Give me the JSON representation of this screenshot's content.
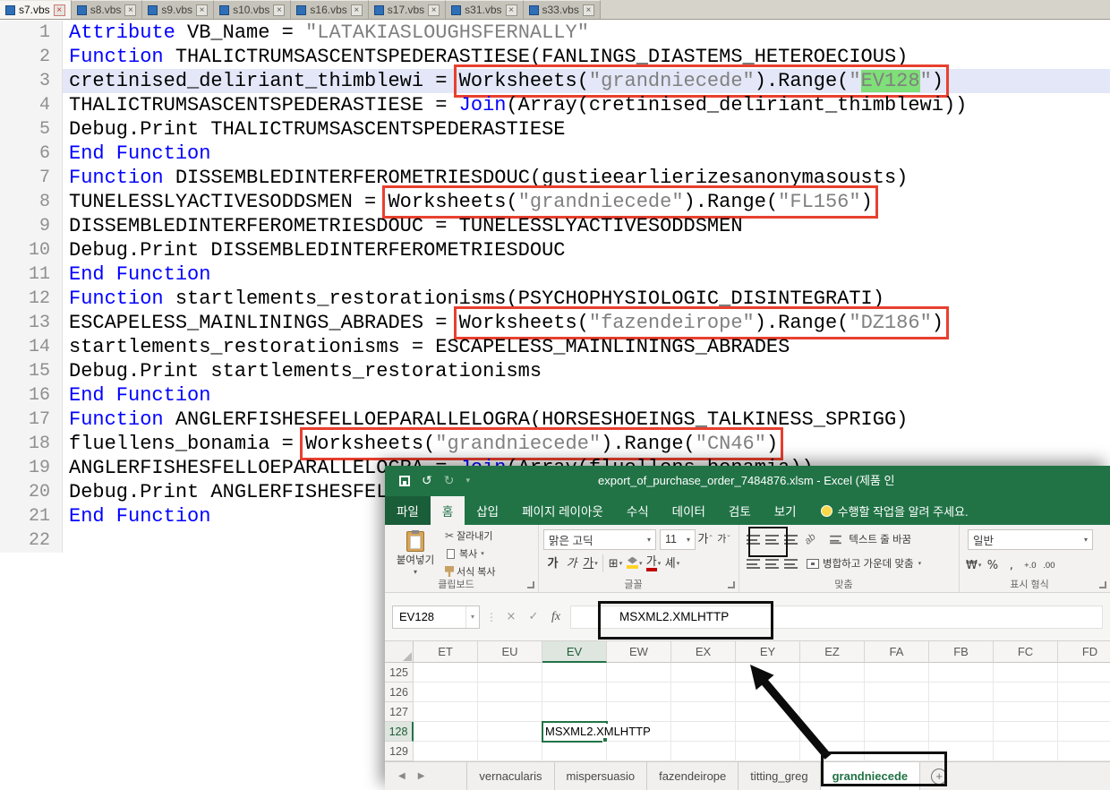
{
  "icons": {
    "close": "×",
    "undo": "↺",
    "redo": "↻",
    "dropdown": "▾",
    "cut": "✂",
    "borders": "⊞",
    "accounting": "₩",
    "percent": "%",
    "comma": ",",
    "inc_decimal": "+.0",
    "dec_decimal": ".00",
    "ellipsis": "⋮",
    "cancel": "×",
    "check": "✓",
    "fx": "fx",
    "nav_prev": "◀",
    "nav_next": "▶",
    "plus": "+",
    "hangul_ga": "가",
    "phonetic": "셰",
    "orientation": "ab"
  },
  "colors": {
    "excel_green": "#217346",
    "annotation_red": "#e8402f",
    "annotation_black": "#101010",
    "keyword_blue": "#0000ff",
    "string_gray": "#808080",
    "highlight_green": "#7fdf78",
    "selected_line": "#e3e7f7"
  },
  "editor": {
    "tabs": [
      {
        "label": "s7.vbs",
        "active": true
      },
      {
        "label": "s8.vbs",
        "active": false
      },
      {
        "label": "s9.vbs",
        "active": false
      },
      {
        "label": "s10.vbs",
        "active": false
      },
      {
        "label": "s16.vbs",
        "active": false
      },
      {
        "label": "s17.vbs",
        "active": false
      },
      {
        "label": "s31.vbs",
        "active": false
      },
      {
        "label": "s33.vbs",
        "active": false
      }
    ],
    "lines": [
      {
        "n": "1",
        "segments": [
          {
            "t": "Attribute",
            "c": "k"
          },
          {
            "t": " VB_Name = ",
            "c": "p"
          },
          {
            "t": "\"LATAKIASLOUGHSFERNALLY\"",
            "c": "s"
          }
        ]
      },
      {
        "n": "2",
        "segments": [
          {
            "t": "Function",
            "c": "k"
          },
          {
            "t": " THALICTRUMSASCENTSPEDERASTIESE(FANLINGS_DIASTEMS_HETEROECIOUS)",
            "c": "p"
          }
        ]
      },
      {
        "n": "3",
        "selected": true,
        "segments": [
          {
            "t": "cretinised_deliriant_thimblewi = ",
            "c": "p"
          },
          {
            "t": "Worksheets(",
            "c": "p",
            "box": true
          },
          {
            "t": "\"grandniecede\"",
            "c": "s",
            "box": true
          },
          {
            "t": ").Range(",
            "c": "p",
            "box": true
          },
          {
            "t": "\"",
            "c": "s",
            "box": true
          },
          {
            "t": "EV128",
            "c": "s",
            "box": true,
            "hl": true
          },
          {
            "t": "\"",
            "c": "s",
            "box": true
          },
          {
            "t": ")",
            "c": "p",
            "box": true
          }
        ]
      },
      {
        "n": "4",
        "segments": [
          {
            "t": "THALICTRUMSASCENTSPEDERASTIESE = ",
            "c": "p"
          },
          {
            "t": "Join",
            "c": "k"
          },
          {
            "t": "(Array(cretinised_deliriant_thimblewi))",
            "c": "p"
          }
        ]
      },
      {
        "n": "5",
        "segments": [
          {
            "t": "Debug.Print THALICTRUMSASCENTSPEDERASTIESE",
            "c": "p"
          }
        ]
      },
      {
        "n": "6",
        "segments": [
          {
            "t": "End Function",
            "c": "k"
          }
        ]
      },
      {
        "n": "7",
        "segments": [
          {
            "t": "Function",
            "c": "k"
          },
          {
            "t": " DISSEMBLEDINTERFEROMETRIESDOUC(gustieearlierizesanonymasousts)",
            "c": "p"
          }
        ]
      },
      {
        "n": "8",
        "segments": [
          {
            "t": "TUNELESSLYACTIVESODDSMEN = ",
            "c": "p"
          },
          {
            "t": "Worksheets(",
            "c": "p",
            "box": true
          },
          {
            "t": "\"grandniecede\"",
            "c": "s",
            "box": true
          },
          {
            "t": ").Range(",
            "c": "p",
            "box": true
          },
          {
            "t": "\"FL156\"",
            "c": "s",
            "box": true
          },
          {
            "t": ")",
            "c": "p",
            "box": true
          }
        ]
      },
      {
        "n": "9",
        "segments": [
          {
            "t": "DISSEMBLEDINTERFEROMETRIESDOUC = TUNELESSLYACTIVESODDSMEN",
            "c": "p"
          }
        ]
      },
      {
        "n": "10",
        "segments": [
          {
            "t": "Debug.Print DISSEMBLEDINTERFEROMETRIESDOUC",
            "c": "p"
          }
        ]
      },
      {
        "n": "11",
        "segments": [
          {
            "t": "End Function",
            "c": "k"
          }
        ]
      },
      {
        "n": "12",
        "segments": [
          {
            "t": "Function",
            "c": "k"
          },
          {
            "t": " startlements_restorationisms(PSYCHOPHYSIOLOGIC_DISINTEGRATI)",
            "c": "p"
          }
        ]
      },
      {
        "n": "13",
        "segments": [
          {
            "t": "ESCAPELESS_MAINLININGS_ABRADES = ",
            "c": "p"
          },
          {
            "t": "Worksheets(",
            "c": "p",
            "box": true
          },
          {
            "t": "\"fazendeirope\"",
            "c": "s",
            "box": true
          },
          {
            "t": ").Range(",
            "c": "p",
            "box": true
          },
          {
            "t": "\"DZ186\"",
            "c": "s",
            "box": true
          },
          {
            "t": ")",
            "c": "p",
            "box": true
          }
        ]
      },
      {
        "n": "14",
        "segments": [
          {
            "t": "startlements_restorationisms = ESCAPELESS_MAINLININGS_ABRADES",
            "c": "p"
          }
        ]
      },
      {
        "n": "15",
        "segments": [
          {
            "t": "Debug.Print startlements_restorationisms",
            "c": "p"
          }
        ]
      },
      {
        "n": "16",
        "segments": [
          {
            "t": "End Function",
            "c": "k"
          }
        ]
      },
      {
        "n": "17",
        "segments": [
          {
            "t": "Function",
            "c": "k"
          },
          {
            "t": " ANGLERFISHESFELLOEPARALLELOGRA(HORSESHOEINGS_TALKINESS_SPRIGG)",
            "c": "p"
          }
        ]
      },
      {
        "n": "18",
        "segments": [
          {
            "t": "fluellens_bonamia = ",
            "c": "p"
          },
          {
            "t": "Worksheets(",
            "c": "p",
            "box": true
          },
          {
            "t": "\"grandniecede\"",
            "c": "s",
            "box": true
          },
          {
            "t": ").Range(",
            "c": "p",
            "box": true
          },
          {
            "t": "\"CN46\"",
            "c": "s",
            "box": true
          },
          {
            "t": ")",
            "c": "p",
            "box": true
          }
        ]
      },
      {
        "n": "19",
        "segments": [
          {
            "t": "ANGLERFISHESFELLOEPARALLELOGRA = ",
            "c": "p"
          },
          {
            "t": "Join",
            "c": "k"
          },
          {
            "t": "(Array(fluellens_bonamia))",
            "c": "p"
          }
        ]
      },
      {
        "n": "20",
        "segments": [
          {
            "t": "Debug.Print ANGLERFISHESFELLOEPARALLELOGRA",
            "c": "p"
          }
        ]
      },
      {
        "n": "21",
        "segments": [
          {
            "t": "End Function",
            "c": "k"
          }
        ]
      },
      {
        "n": "22",
        "segments": []
      }
    ]
  },
  "excel": {
    "title": "export_of_purchase_order_7484876.xlsm - Excel (제품 인",
    "ribbon_tabs": [
      {
        "label": "파일",
        "kind": "file"
      },
      {
        "label": "홈",
        "active": true
      },
      {
        "label": "삽입"
      },
      {
        "label": "페이지 레이아웃"
      },
      {
        "label": "수식"
      },
      {
        "label": "데이터"
      },
      {
        "label": "검토"
      },
      {
        "label": "보기"
      }
    ],
    "tell_me": "수행할 작업을 알려 주세요.",
    "groups": {
      "clipboard": {
        "label": "클립보드",
        "paste": "붙여넣기",
        "cut": "잘라내기",
        "copy": "복사",
        "format_painter": "서식 복사"
      },
      "font": {
        "label": "글꼴",
        "font_name": "맑은 고딕",
        "font_size": "11"
      },
      "alignment": {
        "label": "맞춤",
        "wrap_text": "텍스트 줄 바꿈",
        "merge_center": "병합하고 가운데 맞춤"
      },
      "number": {
        "label": "표시 형식",
        "format": "일반"
      }
    },
    "name_box": "EV128",
    "formula_value": "MSXML2.XMLHTTP",
    "grid": {
      "columns": [
        "ET",
        "EU",
        "EV",
        "EW",
        "EX",
        "EY",
        "EZ",
        "FA",
        "FB",
        "FC",
        "FD"
      ],
      "rows": [
        "125",
        "126",
        "127",
        "128",
        "129"
      ],
      "selected_col": "EV",
      "selected_row": "128",
      "cell_value": "MSXML2.XMLHTTP"
    },
    "sheet_tabs": [
      {
        "label": "vernacularis",
        "active": false
      },
      {
        "label": "mispersuasio",
        "active": false
      },
      {
        "label": "fazendeirope",
        "active": false
      },
      {
        "label": "titting_greg",
        "active": false
      },
      {
        "label": "grandniecede",
        "active": true
      }
    ]
  }
}
